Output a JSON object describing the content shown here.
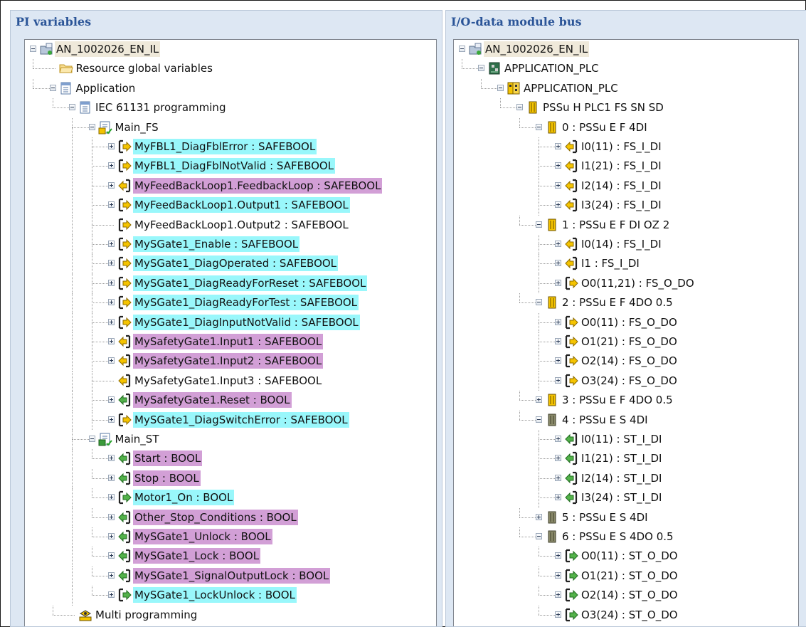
{
  "colors": {
    "highlight_cyan": "#99f7fb",
    "highlight_magenta": "#d29fd6",
    "root_highlight": "#efe9da",
    "panel_title": "#2b5598",
    "panel_bg": "#dde7f3"
  },
  "left_panel": {
    "title": "PI variables",
    "rows": [
      {
        "level": 0,
        "expander": "minus",
        "icon": "project-icon",
        "label": "AN_1002026_EN_IL",
        "hl": "r"
      },
      {
        "level": 1,
        "expander": "none",
        "icon": "folder-icon",
        "label": "Resource global variables",
        "hl": ""
      },
      {
        "level": 1,
        "expander": "minus",
        "icon": "application-icon",
        "label": "Application",
        "hl": ""
      },
      {
        "level": 2,
        "expander": "minus",
        "icon": "application-icon",
        "label": "IEC 61131 programming",
        "hl": ""
      },
      {
        "level": 3,
        "expander": "minus",
        "icon": "program-fs-icon",
        "label": "Main_FS",
        "hl": ""
      },
      {
        "level": 4,
        "expander": "plus",
        "icon": "output-yellow-icon",
        "label": "MyFBL1_DiagFblError : SAFEBOOL",
        "hl": "c"
      },
      {
        "level": 4,
        "expander": "plus",
        "icon": "output-yellow-icon",
        "label": "MyFBL1_DiagFblNotValid : SAFEBOOL",
        "hl": "c"
      },
      {
        "level": 4,
        "expander": "plus",
        "icon": "input-yellow-icon",
        "label": "MyFeedBackLoop1.FeedbackLoop : SAFEBOOL",
        "hl": "m"
      },
      {
        "level": 4,
        "expander": "plus",
        "icon": "output-yellow-icon",
        "label": "MyFeedBackLoop1.Output1 : SAFEBOOL",
        "hl": "c"
      },
      {
        "level": 4,
        "expander": "none",
        "icon": "output-yellow-icon",
        "label": "MyFeedBackLoop1.Output2 : SAFEBOOL",
        "hl": ""
      },
      {
        "level": 4,
        "expander": "plus",
        "icon": "output-yellow-icon",
        "label": "MySGate1_Enable : SAFEBOOL",
        "hl": "c"
      },
      {
        "level": 4,
        "expander": "plus",
        "icon": "output-yellow-icon",
        "label": "MySGate1_DiagOperated : SAFEBOOL",
        "hl": "c"
      },
      {
        "level": 4,
        "expander": "plus",
        "icon": "output-yellow-icon",
        "label": "MySGate1_DiagReadyForReset : SAFEBOOL",
        "hl": "c"
      },
      {
        "level": 4,
        "expander": "plus",
        "icon": "output-yellow-icon",
        "label": "MySGate1_DiagReadyForTest : SAFEBOOL",
        "hl": "c"
      },
      {
        "level": 4,
        "expander": "plus",
        "icon": "output-yellow-icon",
        "label": "MySGate1_DiagInputNotValid : SAFEBOOL",
        "hl": "c"
      },
      {
        "level": 4,
        "expander": "plus",
        "icon": "input-yellow-icon",
        "label": "MySafetyGate1.Input1 : SAFEBOOL",
        "hl": "m"
      },
      {
        "level": 4,
        "expander": "plus",
        "icon": "input-yellow-icon",
        "label": "MySafetyGate1.Input2 : SAFEBOOL",
        "hl": "m"
      },
      {
        "level": 4,
        "expander": "none",
        "icon": "input-yellow-icon",
        "label": "MySafetyGate1.Input3 : SAFEBOOL",
        "hl": ""
      },
      {
        "level": 4,
        "expander": "plus",
        "icon": "input-green-icon",
        "label": "MySafetyGate1.Reset : BOOL",
        "hl": "m"
      },
      {
        "level": 4,
        "expander": "plus",
        "icon": "output-yellow-icon",
        "label": "MySGate1_DiagSwitchError : SAFEBOOL",
        "hl": "c"
      },
      {
        "level": 3,
        "expander": "minus",
        "icon": "program-st-icon",
        "label": "Main_ST",
        "hl": ""
      },
      {
        "level": 4,
        "expander": "plus",
        "icon": "input-green-icon",
        "label": "Start : BOOL",
        "hl": "m"
      },
      {
        "level": 4,
        "expander": "plus",
        "icon": "input-green-icon",
        "label": "Stop : BOOL",
        "hl": "m"
      },
      {
        "level": 4,
        "expander": "plus",
        "icon": "output-green-icon",
        "label": "Motor1_On : BOOL",
        "hl": "c"
      },
      {
        "level": 4,
        "expander": "plus",
        "icon": "input-green-icon",
        "label": "Other_Stop_Conditions : BOOL",
        "hl": "m"
      },
      {
        "level": 4,
        "expander": "plus",
        "icon": "input-green-icon",
        "label": "MySGate1_Unlock : BOOL",
        "hl": "m"
      },
      {
        "level": 4,
        "expander": "plus",
        "icon": "input-green-icon",
        "label": "MySGate1_Lock : BOOL",
        "hl": "m"
      },
      {
        "level": 4,
        "expander": "plus",
        "icon": "input-green-icon",
        "label": "MySGate1_SignalOutputLock : BOOL",
        "hl": "m"
      },
      {
        "level": 4,
        "expander": "plus",
        "icon": "output-green-icon",
        "label": "MySGate1_LockUnlock : BOOL",
        "hl": "c"
      },
      {
        "level": 2,
        "expander": "none",
        "icon": "multi-programming-icon",
        "label": "Multi programming",
        "hl": ""
      }
    ]
  },
  "right_panel": {
    "title": "I/O-data module bus",
    "rows": [
      {
        "level": 0,
        "expander": "minus",
        "icon": "project-icon",
        "label": "AN_1002026_EN_IL",
        "hl": "r"
      },
      {
        "level": 1,
        "expander": "minus",
        "icon": "plc-board-icon",
        "label": "APPLICATION_PLC",
        "hl": ""
      },
      {
        "level": 2,
        "expander": "minus",
        "icon": "plc-module-icon",
        "label": "APPLICATION_PLC",
        "hl": ""
      },
      {
        "level": 3,
        "expander": "minus",
        "icon": "module-yellow-icon",
        "label": "PSSu H PLC1 FS SN SD",
        "hl": ""
      },
      {
        "level": 4,
        "expander": "minus",
        "icon": "module-yellow-icon",
        "label": "0 : PSSu E F 4DI",
        "hl": ""
      },
      {
        "level": 5,
        "expander": "plus",
        "icon": "input-yellow-icon",
        "label": "I0(11) : FS_I_DI",
        "hl": ""
      },
      {
        "level": 5,
        "expander": "plus",
        "icon": "input-yellow-icon",
        "label": "I1(21) : FS_I_DI",
        "hl": ""
      },
      {
        "level": 5,
        "expander": "plus",
        "icon": "input-yellow-icon",
        "label": "I2(14) : FS_I_DI",
        "hl": ""
      },
      {
        "level": 5,
        "expander": "plus",
        "icon": "input-yellow-icon",
        "label": "I3(24) : FS_I_DI",
        "hl": ""
      },
      {
        "level": 4,
        "expander": "minus",
        "icon": "module-yellow-icon",
        "label": "1 : PSSu E F DI OZ 2",
        "hl": ""
      },
      {
        "level": 5,
        "expander": "plus",
        "icon": "input-yellow-icon",
        "label": "I0(14) : FS_I_DI",
        "hl": ""
      },
      {
        "level": 5,
        "expander": "plus",
        "icon": "input-yellow-icon",
        "label": "I1 : FS_I_DI",
        "hl": ""
      },
      {
        "level": 5,
        "expander": "plus",
        "icon": "output-yellow-icon",
        "label": "O0(11,21) : FS_O_DO",
        "hl": ""
      },
      {
        "level": 4,
        "expander": "minus",
        "icon": "module-yellow-icon",
        "label": "2 : PSSu E F 4DO 0.5",
        "hl": ""
      },
      {
        "level": 5,
        "expander": "plus",
        "icon": "output-yellow-icon",
        "label": "O0(11) : FS_O_DO",
        "hl": ""
      },
      {
        "level": 5,
        "expander": "plus",
        "icon": "output-yellow-icon",
        "label": "O1(21) : FS_O_DO",
        "hl": ""
      },
      {
        "level": 5,
        "expander": "plus",
        "icon": "output-yellow-icon",
        "label": "O2(14) : FS_O_DO",
        "hl": ""
      },
      {
        "level": 5,
        "expander": "plus",
        "icon": "output-yellow-icon",
        "label": "O3(24) : FS_O_DO",
        "hl": ""
      },
      {
        "level": 4,
        "expander": "plus",
        "icon": "module-yellow-icon",
        "label": "3 : PSSu E F 4DO 0.5",
        "hl": ""
      },
      {
        "level": 4,
        "expander": "minus",
        "icon": "module-gray-icon",
        "label": "4 : PSSu E S 4DI",
        "hl": ""
      },
      {
        "level": 5,
        "expander": "plus",
        "icon": "input-green-icon",
        "label": "I0(11) : ST_I_DI",
        "hl": ""
      },
      {
        "level": 5,
        "expander": "plus",
        "icon": "input-green-icon",
        "label": "I1(21) : ST_I_DI",
        "hl": ""
      },
      {
        "level": 5,
        "expander": "plus",
        "icon": "input-green-icon",
        "label": "I2(14) : ST_I_DI",
        "hl": ""
      },
      {
        "level": 5,
        "expander": "plus",
        "icon": "input-green-icon",
        "label": "I3(24) : ST_I_DI",
        "hl": ""
      },
      {
        "level": 4,
        "expander": "plus",
        "icon": "module-gray-icon",
        "label": "5 : PSSu E S 4DI",
        "hl": ""
      },
      {
        "level": 4,
        "expander": "minus",
        "icon": "module-gray-icon",
        "label": "6 : PSSu E S 4DO 0.5",
        "hl": ""
      },
      {
        "level": 5,
        "expander": "plus",
        "icon": "output-green-icon",
        "label": "O0(11) : ST_O_DO",
        "hl": ""
      },
      {
        "level": 5,
        "expander": "plus",
        "icon": "output-green-icon",
        "label": "O1(21) : ST_O_DO",
        "hl": ""
      },
      {
        "level": 5,
        "expander": "plus",
        "icon": "output-green-icon",
        "label": "O2(14) : ST_O_DO",
        "hl": ""
      },
      {
        "level": 5,
        "expander": "plus",
        "icon": "output-green-icon",
        "label": "O3(24) : ST_O_DO",
        "hl": ""
      }
    ]
  }
}
